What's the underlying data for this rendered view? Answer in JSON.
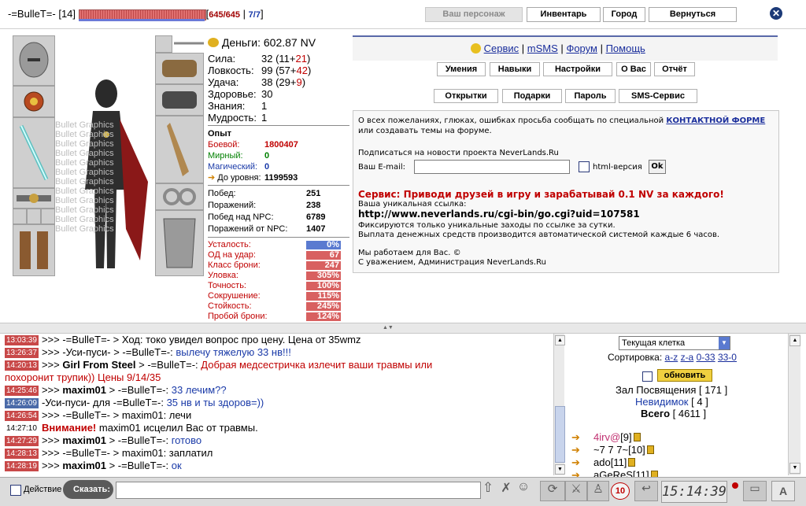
{
  "header": {
    "name": "-=BulleT=-",
    "level": "[14]",
    "hp": "645/645",
    "mp": "7/7",
    "hp_bracket_open": "[",
    "sep": "|",
    "hp_bracket_close": "]",
    "buttons": {
      "character": "Ваш персонаж",
      "inventory": "Инвентарь",
      "city": "Город",
      "back": "Вернуться"
    },
    "close": "✕"
  },
  "watermark": "Bullet Graphics",
  "stats": {
    "money_label": "Деньги:",
    "money": "602.87 NV",
    "rows": [
      {
        "label": "Сила:",
        "base": "32",
        "detail_open": " (11+",
        "bonus": "21",
        "detail_close": ")"
      },
      {
        "label": "Ловкость:",
        "base": "99",
        "detail_open": " (57+",
        "bonus": "42",
        "detail_close": ")"
      },
      {
        "label": "Удача:",
        "base": "38",
        "detail_open": " (29+",
        "bonus": "9",
        "detail_close": ")"
      },
      {
        "label": "Здоровье:",
        "base": "30"
      },
      {
        "label": "Знания:",
        "base": "1"
      },
      {
        "label": "Мудрость:",
        "base": "1"
      }
    ],
    "exp_title": "Опыт",
    "exp": [
      {
        "label": "Боевой:",
        "value": "1800407",
        "color": "#c00000"
      },
      {
        "label": "Мирный:",
        "value": "0",
        "color": "#008000"
      },
      {
        "label": "Магический:",
        "value": "0",
        "color": "#1a3aa8"
      },
      {
        "label": "До уровня:",
        "value": "1199593",
        "color": "#000000"
      }
    ],
    "battles": [
      {
        "label": "Побед:",
        "value": "251"
      },
      {
        "label": "Поражений:",
        "value": "238"
      },
      {
        "label": "Побед над NPC:",
        "value": "6789"
      },
      {
        "label": "Поражений от NPC:",
        "value": "1407"
      }
    ],
    "combat": [
      {
        "label": "Усталость:",
        "value": "0%"
      },
      {
        "label": "ОД на удар:",
        "value": "67"
      },
      {
        "label": "Класс брони:",
        "value": "247"
      },
      {
        "label": "Уловка:",
        "value": "305%"
      },
      {
        "label": "Точность:",
        "value": "100%"
      },
      {
        "label": "Сокрушение:",
        "value": "115%"
      },
      {
        "label": "Стойкость:",
        "value": "245%"
      },
      {
        "label": "Пробой брони:",
        "value": "124%"
      }
    ]
  },
  "panel": {
    "links": [
      "Сервис",
      "mSMS",
      "Форум",
      "Помощь"
    ],
    "link_sep": "|",
    "buttons_row1": [
      "Умения",
      "Навыки",
      "Настройки",
      "О Вас",
      "Отчёт"
    ],
    "buttons_row2": [
      "Открытки",
      "Подарки",
      "Пароль",
      "SMS-Сервис"
    ],
    "info": {
      "p1a": "О всех пожеланиях, глюках, ошибках просьба сообщать по специальной ",
      "p1link": "КОНТАКТНОЙ ФОРМЕ",
      "p1b": " или создавать темы на форуме.",
      "subscribe": "Подписаться на новости проекта NeverLands.Ru",
      "email_label": "Ваш E-mail:",
      "html_label": "html-версия",
      "ok": "Ok",
      "service_title": "Сервис: Приводи друзей в игру и зарабатывай 0.1 NV за каждого!",
      "your_link": "Ваша уникальная ссылка:",
      "url": "http://www.neverlands.ru/cgi-bin/go.cgi?uid=107581",
      "note1": "Фиксируются только уникальные заходы по ссылке за сутки.",
      "note2": "Выплата денежных средств производится автоматической системой каждые 6 часов.",
      "sig1": "Мы работаем для Вас. ©",
      "sig2": "С уважением, Администрация NeverLands.Ru"
    }
  },
  "chat": [
    {
      "time": "13:03:39",
      "ts": "r",
      "parts": [
        {
          "t": ">>> -=BulleT=- > Ход: токо увидел вопрос про цену. Цена от 35wmz"
        }
      ]
    },
    {
      "time": "13:26:37",
      "ts": "r",
      "parts": [
        {
          "t": ">>> -Уси-пуси- > -=BulleT=-: "
        },
        {
          "t": "вылечу тяжелую 33 нв!!!",
          "c": "#1a3aa8"
        }
      ]
    },
    {
      "time": "14:20:13",
      "ts": "r",
      "parts": [
        {
          "t": ">>> "
        },
        {
          "t": "Girl From Steel",
          "b": 1
        },
        {
          "t": " > -=BulleT=-: "
        },
        {
          "t": "Добрая медсестричка излечит ваши травмы или",
          "c": "#c00000"
        }
      ]
    },
    {
      "time": "",
      "ts": "",
      "parts": [
        {
          "t": "похоронит трупик)) Цены 9/14/35",
          "c": "#c00000"
        }
      ]
    },
    {
      "time": "14:25:46",
      "ts": "r",
      "parts": [
        {
          "t": ">>> "
        },
        {
          "t": "maxim01",
          "b": 1
        },
        {
          "t": " > -=BulleT=-: "
        },
        {
          "t": "33 лечим??",
          "c": "#1a3aa8"
        }
      ]
    },
    {
      "time": "14:26:09",
      "ts": "b",
      "parts": [
        {
          "t": "-Уси-пуси- для -=BulleT=-: "
        },
        {
          "t": "35 нв и ты здоров=))",
          "c": "#1a3aa8"
        }
      ]
    },
    {
      "time": "14:26:54",
      "ts": "r",
      "parts": [
        {
          "t": ">>> -=BulleT=- > maxim01: лечи"
        }
      ]
    },
    {
      "time": "14:27:10",
      "ts": "n",
      "parts": [
        {
          "t": "Внимание!",
          "b": 1,
          "c": "#c00000"
        },
        {
          "t": " maxim01 исцелил Вас от травмы."
        }
      ]
    },
    {
      "time": "14:27:29",
      "ts": "r",
      "parts": [
        {
          "t": ">>> "
        },
        {
          "t": "maxim01",
          "b": 1
        },
        {
          "t": " > -=BulleT=-: "
        },
        {
          "t": "готово",
          "c": "#1a3aa8"
        }
      ]
    },
    {
      "time": "14:28:13",
      "ts": "r",
      "parts": [
        {
          "t": ">>> -=BulleT=- > maxim01: заплатил"
        }
      ]
    },
    {
      "time": "14:28:19",
      "ts": "r",
      "parts": [
        {
          "t": ">>> "
        },
        {
          "t": "maxim01",
          "b": 1
        },
        {
          "t": " > -=BulleT=-: "
        },
        {
          "t": "ок",
          "c": "#1a3aa8"
        }
      ]
    }
  ],
  "users": {
    "select": "Текущая клетка",
    "sort_label": "Сортировка:",
    "sort_links": [
      "a-z",
      "z-a",
      "0-33",
      "33-0"
    ],
    "refresh": "обновить",
    "hall": "Зал Посвящения",
    "hall_count": "[ 171 ]",
    "invisible": "Невидимок",
    "invisible_count": "[ 4 ]",
    "total": "Всего",
    "total_count": "[ 4611 ]",
    "list": [
      {
        "name": "4irv@",
        "lvl": "[9]",
        "color": "#c03070"
      },
      {
        "name": "~7 7 7~",
        "lvl": "[10]",
        "color": "#000000"
      },
      {
        "name": "ado",
        "lvl": "[11]",
        "color": "#000000"
      },
      {
        "name": "aGeReS",
        "lvl": "[11]",
        "color": "#000000"
      }
    ]
  },
  "bottom": {
    "action": "Действие",
    "say": "Сказать:",
    "counter": "10",
    "clock": "15:14:39"
  }
}
